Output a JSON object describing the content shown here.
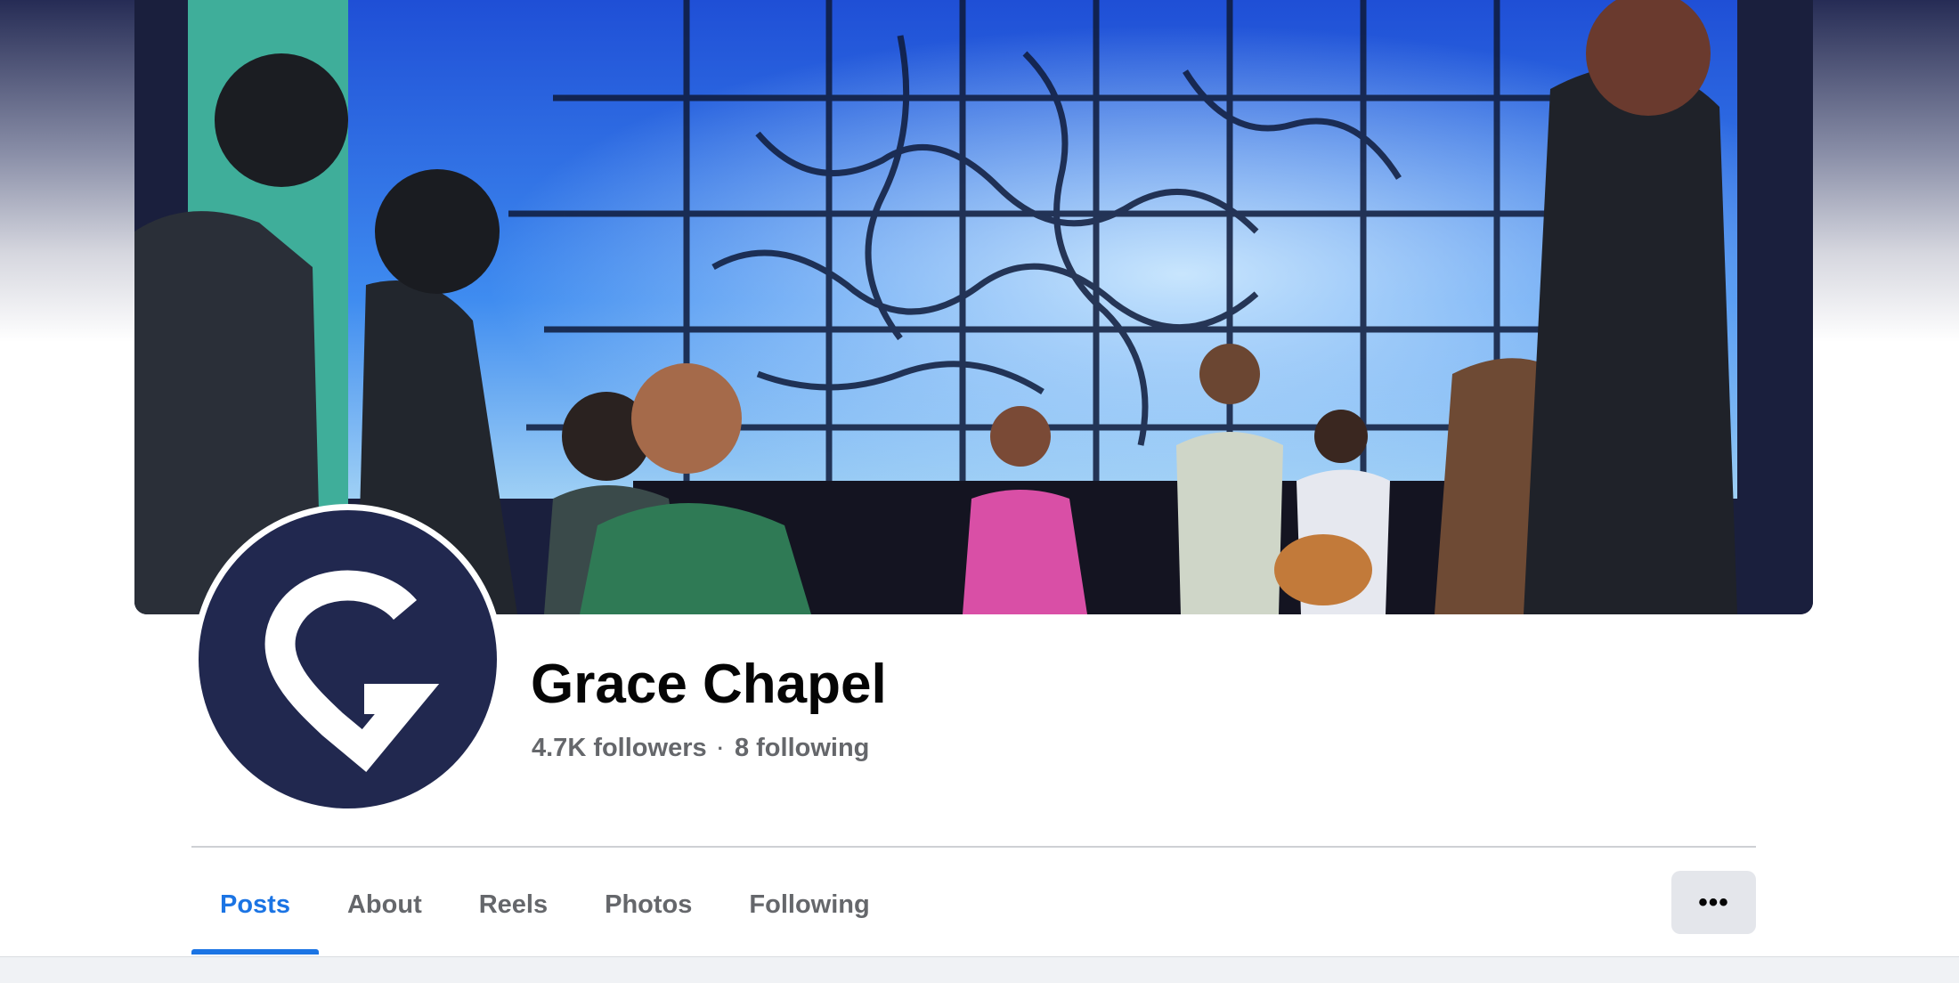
{
  "profile": {
    "name": "Grace Chapel",
    "followers": "4.7K followers",
    "separator": "·",
    "following": "8 following"
  },
  "tabs": [
    {
      "label": "Posts",
      "active": true
    },
    {
      "label": "About"
    },
    {
      "label": "Reels"
    },
    {
      "label": "Photos"
    },
    {
      "label": "Following"
    }
  ],
  "more_button": {
    "label": "•••",
    "icon": "more-horizontal-icon"
  },
  "colors": {
    "accent": "#1b74e4",
    "avatar_bg": "#21284f",
    "text_primary": "#050505",
    "text_secondary": "#65676b"
  }
}
